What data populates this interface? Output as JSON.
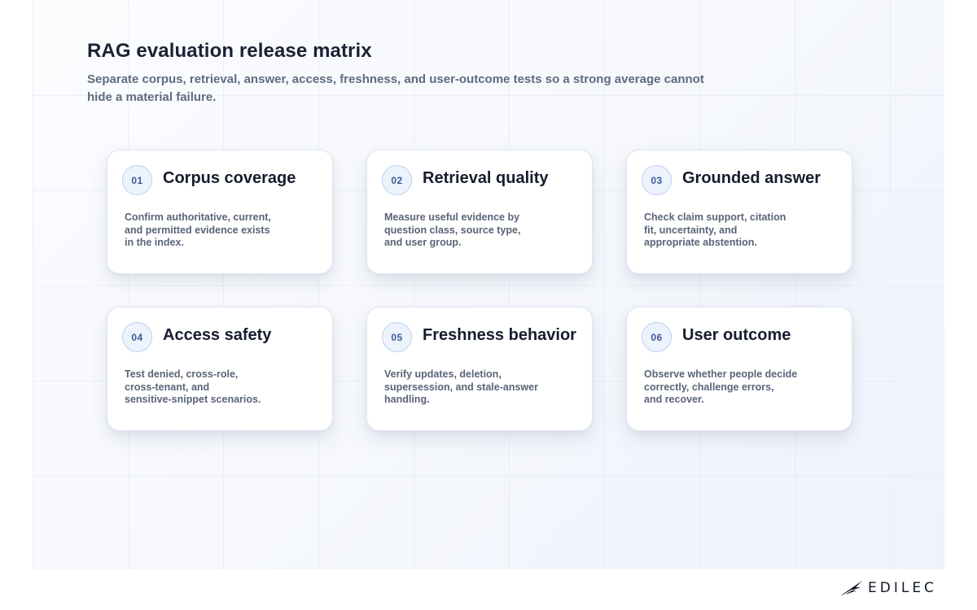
{
  "header": {
    "title": "RAG evaluation release matrix",
    "subtitle_lines": [
      "Separate corpus, retrieval, answer, access, freshness, and user-outcome tests so a strong average cannot",
      "hide a material failure."
    ]
  },
  "cards": [
    {
      "number": "01",
      "title": "Corpus coverage",
      "lines": [
        "Confirm authoritative, current,",
        "and permitted evidence exists",
        "in the index."
      ]
    },
    {
      "number": "02",
      "title": "Retrieval quality",
      "lines": [
        "Measure useful evidence by",
        "question class, source type,",
        "and user group."
      ]
    },
    {
      "number": "03",
      "title": "Grounded answer",
      "lines": [
        "Check claim support, citation",
        "fit, uncertainty, and",
        "appropriate abstention."
      ]
    },
    {
      "number": "04",
      "title": "Access safety",
      "lines": [
        "Test denied, cross-role,",
        "cross-tenant, and",
        "sensitive-snippet scenarios."
      ]
    },
    {
      "number": "05",
      "title": "Freshness behavior",
      "lines": [
        "Verify updates, deletion,",
        "supersession, and stale-answer",
        "handling."
      ]
    },
    {
      "number": "06",
      "title": "User outcome",
      "lines": [
        "Observe whether people decide",
        "correctly, challenge errors,",
        "and recover."
      ]
    }
  ],
  "logo": {
    "icon": "edilec-wing-icon",
    "text": "EDILEC"
  },
  "colors": {
    "badge_fill": "#edf3fd",
    "badge_border": "#bcd0ee",
    "badge_text": "#3b5a95",
    "title_text": "#1a2235",
    "body_text": "#5a6478"
  }
}
